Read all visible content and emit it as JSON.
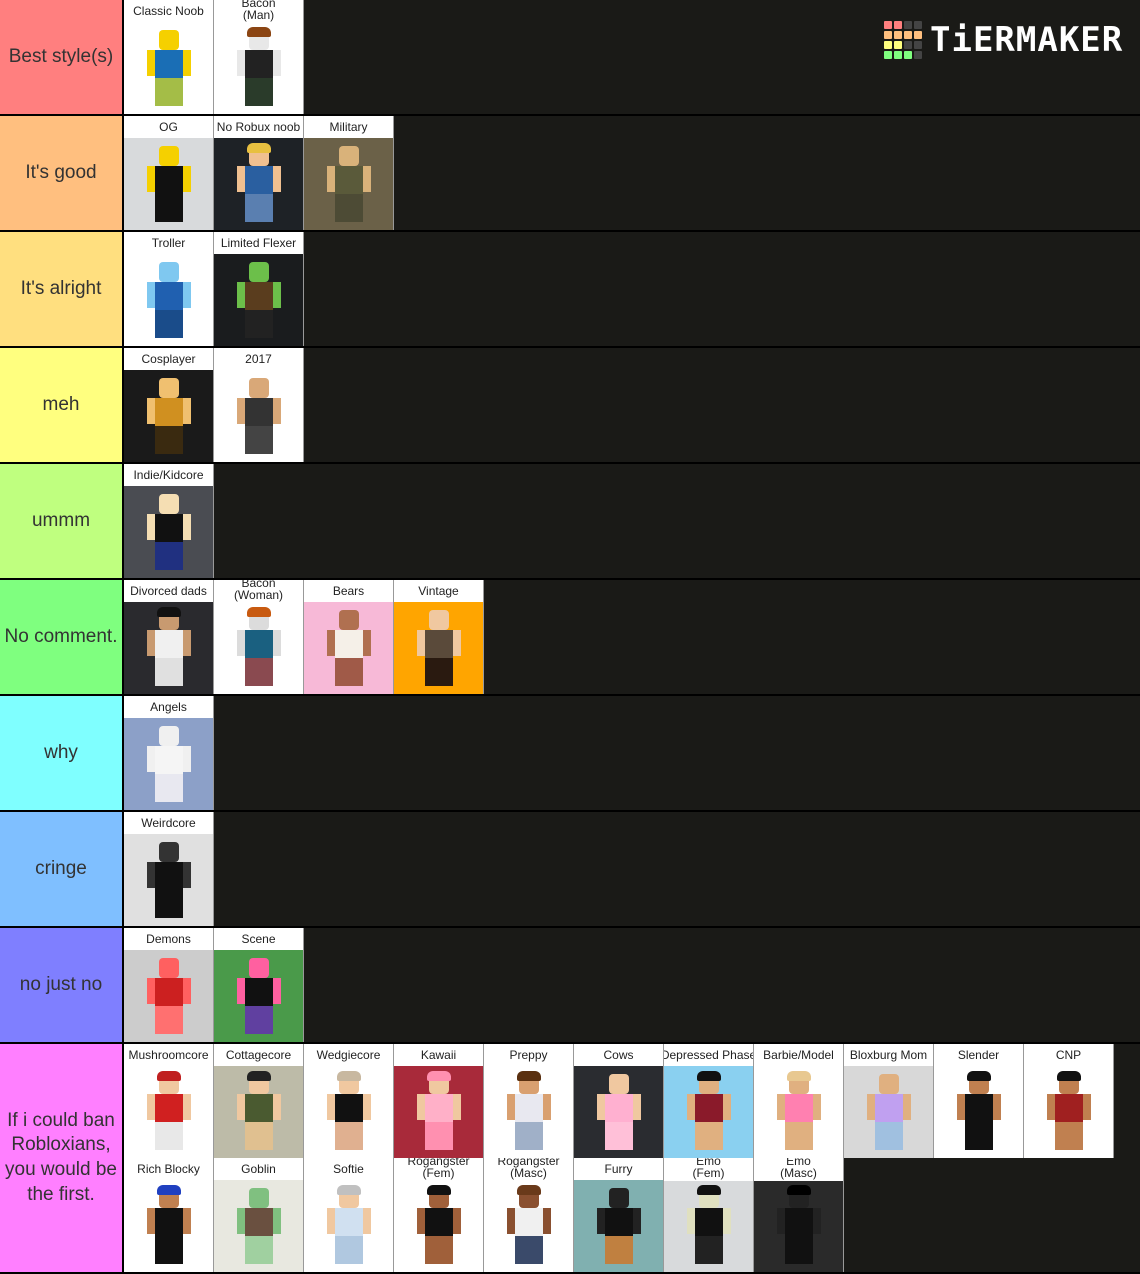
{
  "brand": {
    "name": "TiERMAKER",
    "logo_colors": [
      "#ff7f7f",
      "#ff7f7f",
      "#444444",
      "#444444",
      "#ffbf7f",
      "#ffbf7f",
      "#ffbf7f",
      "#ffbf7f",
      "#ffff7f",
      "#ffff7f",
      "#444444",
      "#444444",
      "#7fff7f",
      "#7fff7f",
      "#7fff7f",
      "#444444"
    ]
  },
  "tiers": [
    {
      "label": "Best style(s)",
      "color": "#ff7f7f",
      "items": [
        {
          "name": "Classic Noob",
          "bg": "#ffffff",
          "skin": "#f5d000",
          "torso": "#1a6eb5",
          "legs": "#a4bd47"
        },
        {
          "name": "Bacon\n(Man)",
          "bg": "#ffffff",
          "skin": "#e8e8e8",
          "torso": "#222222",
          "legs": "#2a3b2a",
          "hair": "#8b4513"
        }
      ]
    },
    {
      "label": "It's good",
      "color": "#ffbf7f",
      "items": [
        {
          "name": "OG",
          "bg": "#d8dadc",
          "skin": "#f5d000",
          "torso": "#111111",
          "legs": "#111111"
        },
        {
          "name": "No Robux noob",
          "bg": "#1e2226",
          "skin": "#f0c090",
          "torso": "#2a5fa0",
          "legs": "#5a7fb0",
          "hair": "#e8c040"
        },
        {
          "name": "Military",
          "bg": "#6b6148",
          "skin": "#d9b27a",
          "torso": "#5a5a3a",
          "legs": "#4d4b35"
        }
      ]
    },
    {
      "label": "It's alright",
      "color": "#ffdf7f",
      "items": [
        {
          "name": "Troller",
          "bg": "#ffffff",
          "skin": "#7fc8f0",
          "torso": "#2060b0",
          "legs": "#1a4c8a"
        },
        {
          "name": "Limited Flexer",
          "bg": "#1a1c1e",
          "skin": "#6cbf4a",
          "torso": "#5a3d1e",
          "legs": "#222222"
        }
      ]
    },
    {
      "label": "meh",
      "color": "#ffff7f",
      "items": [
        {
          "name": "Cosplayer",
          "bg": "#1a1a1a",
          "skin": "#f0c070",
          "torso": "#d09020",
          "legs": "#3a2a10"
        },
        {
          "name": "2017",
          "bg": "#ffffff",
          "skin": "#d9a878",
          "torso": "#333333",
          "legs": "#444444"
        }
      ]
    },
    {
      "label": "ummm",
      "color": "#bfff7f",
      "items": [
        {
          "name": "Indie/Kidcore",
          "bg": "#4a4c52",
          "skin": "#f5deb3",
          "torso": "#111111",
          "legs": "#203080"
        }
      ]
    },
    {
      "label": "No comment.",
      "color": "#7fff7f",
      "items": [
        {
          "name": "Divorced dads",
          "bg": "#2a2a2e",
          "skin": "#c89a70",
          "torso": "#f0f0f0",
          "legs": "#e0e0e0",
          "hair": "#111111"
        },
        {
          "name": "Bacon\n(Woman)",
          "bg": "#ffffff",
          "skin": "#dcdcdc",
          "torso": "#1a6080",
          "legs": "#8a4a50",
          "hair": "#c85a10"
        },
        {
          "name": "Bears",
          "bg": "#f7b9d7",
          "skin": "#b07050",
          "torso": "#f5f0e8",
          "legs": "#a05a48"
        },
        {
          "name": "Vintage",
          "bg": "#ffa500",
          "skin": "#f0c8a0",
          "torso": "#5a4a3a",
          "legs": "#2a1a10"
        }
      ]
    },
    {
      "label": "why",
      "color": "#7fffff",
      "items": [
        {
          "name": "Angels",
          "bg": "#8ca0c8",
          "skin": "#f0f0f0",
          "torso": "#f5f5f5",
          "legs": "#e8e8f0"
        }
      ]
    },
    {
      "label": "cringe",
      "color": "#7fbfff",
      "items": [
        {
          "name": "Weirdcore",
          "bg": "#e0e0e0",
          "skin": "#333333",
          "torso": "#111111",
          "legs": "#111111"
        }
      ]
    },
    {
      "label": "no just no",
      "color": "#7f7fff",
      "items": [
        {
          "name": "Demons",
          "bg": "#cccccc",
          "skin": "#ff6060",
          "torso": "#cc2020",
          "legs": "#ff7070"
        },
        {
          "name": "Scene",
          "bg": "#4a9a4a",
          "skin": "#ff60a0",
          "torso": "#111111",
          "legs": "#6040a0"
        }
      ]
    },
    {
      "label": "If i could ban Robloxians, you would be the first.",
      "color": "#ff7fff",
      "items": [
        {
          "name": "Mushroomcore",
          "bg": "#ffffff",
          "skin": "#f0c8a0",
          "torso": "#d02020",
          "legs": "#e8e8e8",
          "hair": "#c02020"
        },
        {
          "name": "Cottagecore",
          "bg": "#bdbba8",
          "skin": "#f0c8a0",
          "torso": "#4a5a30",
          "legs": "#e0c090",
          "hair": "#222222"
        },
        {
          "name": "Wedgiecore",
          "bg": "#ffffff",
          "skin": "#f0c8a0",
          "torso": "#111111",
          "legs": "#e0b090",
          "hair": "#c8b8a0"
        },
        {
          "name": "Kawaii",
          "bg": "#a82a3a",
          "skin": "#f0c8a0",
          "torso": "#ffb0c8",
          "legs": "#ff90b0",
          "hair": "#ff90b0"
        },
        {
          "name": "Preppy",
          "bg": "#ffffff",
          "skin": "#d9a070",
          "torso": "#e8e8f0",
          "legs": "#a0b0c8",
          "hair": "#5a3010"
        },
        {
          "name": "Cows",
          "bg": "#2a2c30",
          "skin": "#f0c8a0",
          "torso": "#ffb0d0",
          "legs": "#ffc0d8"
        },
        {
          "name": "Depressed Phase",
          "bg": "#8ad0f0",
          "skin": "#e0b080",
          "torso": "#8a1a2a",
          "legs": "#e0b080",
          "hair": "#111111"
        },
        {
          "name": "Barbie/Model",
          "bg": "#ffffff",
          "skin": "#e0b080",
          "torso": "#ff80b0",
          "legs": "#e0b080",
          "hair": "#e8c890"
        },
        {
          "name": "Bloxburg Mom",
          "bg": "#d8d8d8",
          "skin": "#e0b080",
          "torso": "#c0a0f0",
          "legs": "#a0c0e0"
        },
        {
          "name": "Slender",
          "bg": "#ffffff",
          "skin": "#c08050",
          "torso": "#111111",
          "legs": "#111111",
          "hair": "#111111"
        },
        {
          "name": "CNP",
          "bg": "#ffffff",
          "skin": "#c08050",
          "torso": "#a02020",
          "legs": "#c08050",
          "hair": "#111111"
        },
        {
          "name": "Rich Blocky",
          "bg": "#ffffff",
          "skin": "#c08050",
          "torso": "#111111",
          "legs": "#111111",
          "hair": "#2040c0"
        },
        {
          "name": "Goblin",
          "bg": "#e8e8e0",
          "skin": "#80c080",
          "torso": "#6a5040",
          "legs": "#a0d0a0"
        },
        {
          "name": "Softie",
          "bg": "#ffffff",
          "skin": "#f0c8a0",
          "torso": "#d0e0f0",
          "legs": "#b0c8e0",
          "hair": "#c0c0c0"
        },
        {
          "name": "Rogangster\n(Fem)",
          "bg": "#ffffff",
          "skin": "#a0603a",
          "torso": "#111111",
          "legs": "#a0603a",
          "hair": "#111111"
        },
        {
          "name": "Rogangster\n(Masc)",
          "bg": "#ffffff",
          "skin": "#8a5030",
          "torso": "#f0f0f0",
          "legs": "#3a4a6a",
          "hair": "#6a3a1a"
        },
        {
          "name": "Furry",
          "bg": "#80b0b0",
          "skin": "#222222",
          "torso": "#111111",
          "legs": "#c08040"
        },
        {
          "name": "Emo\n(Fem)",
          "bg": "#d8dadc",
          "skin": "#e0e0c0",
          "torso": "#111111",
          "legs": "#222222",
          "hair": "#111111"
        },
        {
          "name": "Emo\n(Masc)",
          "bg": "#2a2a2a",
          "skin": "#222222",
          "torso": "#111111",
          "legs": "#111111",
          "hair": "#000000"
        }
      ]
    }
  ]
}
